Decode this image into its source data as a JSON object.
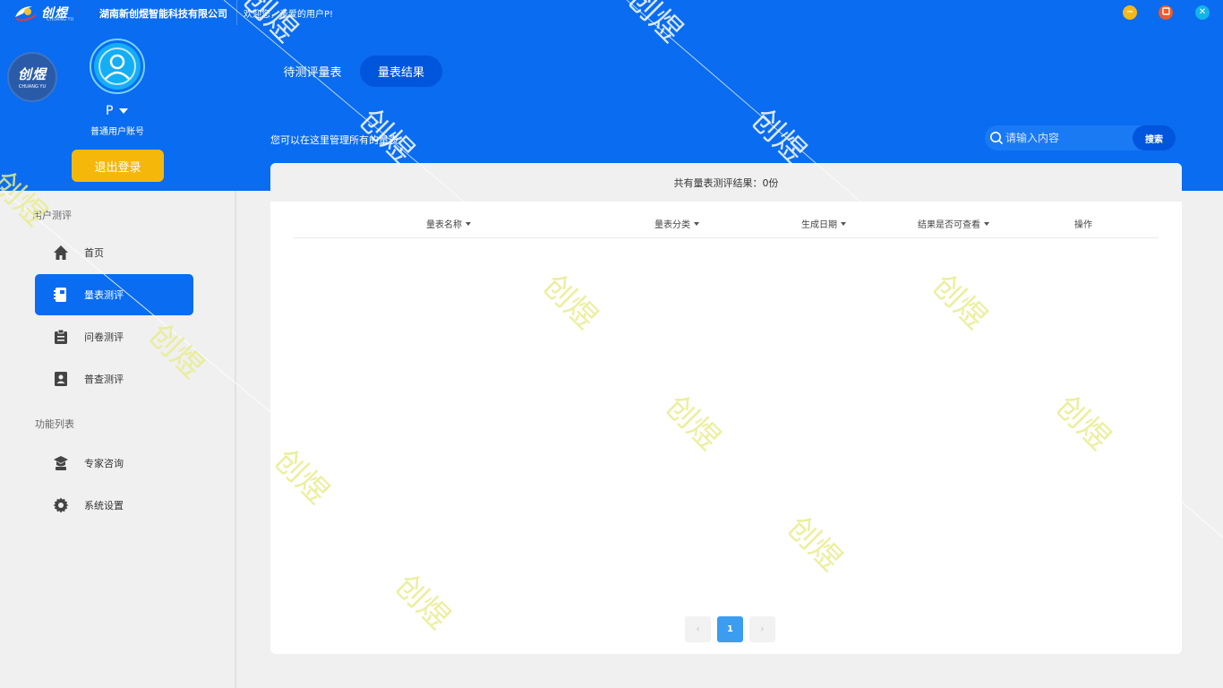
{
  "titlebar": {
    "logo_text": "创煜",
    "logo_sub": "CHUANG YU",
    "company": "湖南新创煜智能科技有限公司",
    "welcome": "欢迎您，亲爱的用户P!"
  },
  "sidebar": {
    "badge_text": "创煜",
    "badge_sub": "CHUANG YU",
    "username": "P",
    "account_type": "普通用户账号",
    "logout_label": "退出登录",
    "sections": [
      {
        "title": "用户测评",
        "items": [
          {
            "label": "首页",
            "icon": "home-icon",
            "active": false
          },
          {
            "label": "量表测评",
            "icon": "notebook-icon",
            "active": true
          },
          {
            "label": "问卷测评",
            "icon": "clipboard-icon",
            "active": false
          },
          {
            "label": "普查测评",
            "icon": "census-icon",
            "active": false
          }
        ]
      },
      {
        "title": "功能列表",
        "items": [
          {
            "label": "专家咨询",
            "icon": "graduation-cap-icon",
            "active": false
          },
          {
            "label": "系统设置",
            "icon": "gear-icon",
            "active": false
          }
        ]
      }
    ]
  },
  "header": {
    "tabs": [
      {
        "label": "待测评量表",
        "active": false
      },
      {
        "label": "量表结果",
        "active": true
      }
    ],
    "description": "您可以在这里管理所有的量表"
  },
  "search": {
    "placeholder": "请输入内容",
    "button_label": "搜索"
  },
  "table": {
    "summary": "共有量表测评结果：0份",
    "columns": [
      "量表名称",
      "量表分类",
      "生成日期",
      "结果是否可查看",
      "操作"
    ],
    "rows": []
  },
  "pagination": {
    "prev": "‹",
    "current_page": "1",
    "next": "›"
  },
  "watermark_text": "创煜",
  "colors": {
    "brand_blue": "#0a6cf0",
    "logout_yellow": "#f5b80a",
    "pager_active": "#3c9cf0",
    "watermark": "#e8ec8c"
  }
}
